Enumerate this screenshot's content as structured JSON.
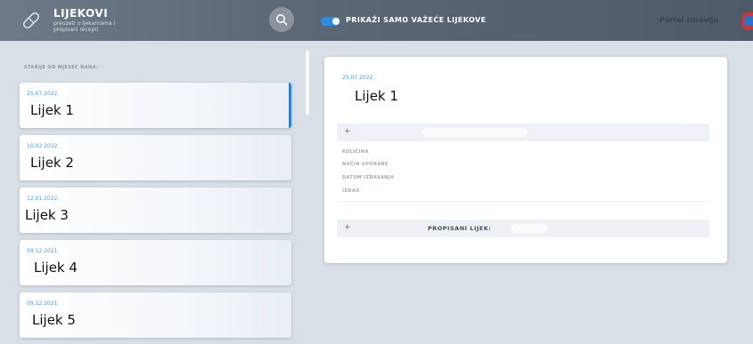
{
  "header": {
    "title": "LIJEKOVI",
    "subtitle": "preuzeti u ljekarnama i propisani recepti",
    "toggle_label": "PRIKAŽI SAMO VAŽEĆE LIJEKOVE",
    "toggle_on": true,
    "portal_label": "Portal zdravlja",
    "accent_color": "#2b8ce6"
  },
  "list": {
    "heading": "STARIJE OD MJESEC DANA:",
    "items": [
      {
        "date": "25.07.2022.",
        "name": "Lijek 1",
        "active": true
      },
      {
        "date": "10.02.2022.",
        "name": "Lijek 2",
        "active": false
      },
      {
        "date": "12.01.2022.",
        "name": "Lijek 3",
        "active": false
      },
      {
        "date": "09.12.2021.",
        "name": "Lijek 4",
        "active": false
      },
      {
        "date": "09.12.2021.",
        "name": "Lijek 5",
        "active": false
      }
    ]
  },
  "detail": {
    "date": "25.07.2022.",
    "name": "Lijek 1",
    "expand_symbol": "+",
    "fields": [
      "KOLIČINA",
      "NAČIN UPORABE",
      "DATUM IZDAVANJA",
      "IZDAO"
    ],
    "prescribed_label": "PROPISANI LIJEK:"
  }
}
